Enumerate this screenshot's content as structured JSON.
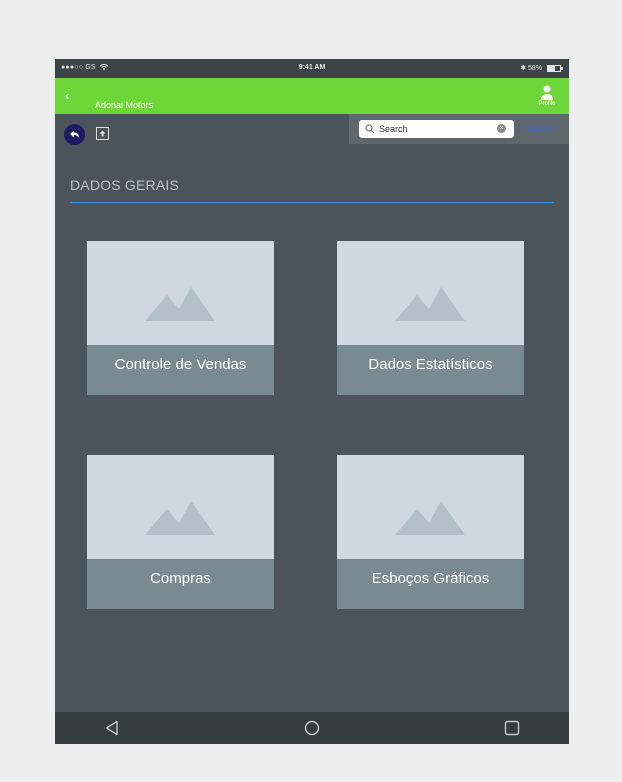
{
  "status_bar": {
    "carrier": "●●●○○ GS",
    "time": "9:41 AM",
    "battery": "✱ 58%"
  },
  "app_bar": {
    "title": "Adonai Motors",
    "profile_label": "Profile"
  },
  "search": {
    "placeholder": "Search",
    "cancel_label": "Cancel"
  },
  "section": {
    "title": "DADOS GERAIS"
  },
  "cards": [
    {
      "label": "Controle de Vendas"
    },
    {
      "label": "Dados Estatísticos"
    },
    {
      "label": "Compras"
    },
    {
      "label": "Esboços Gráficos"
    }
  ],
  "colors": {
    "accent_green": "#6fd63a",
    "background": "#4a545a",
    "divider_blue": "#3c8cf0",
    "undo_button": "#1d1a63"
  }
}
